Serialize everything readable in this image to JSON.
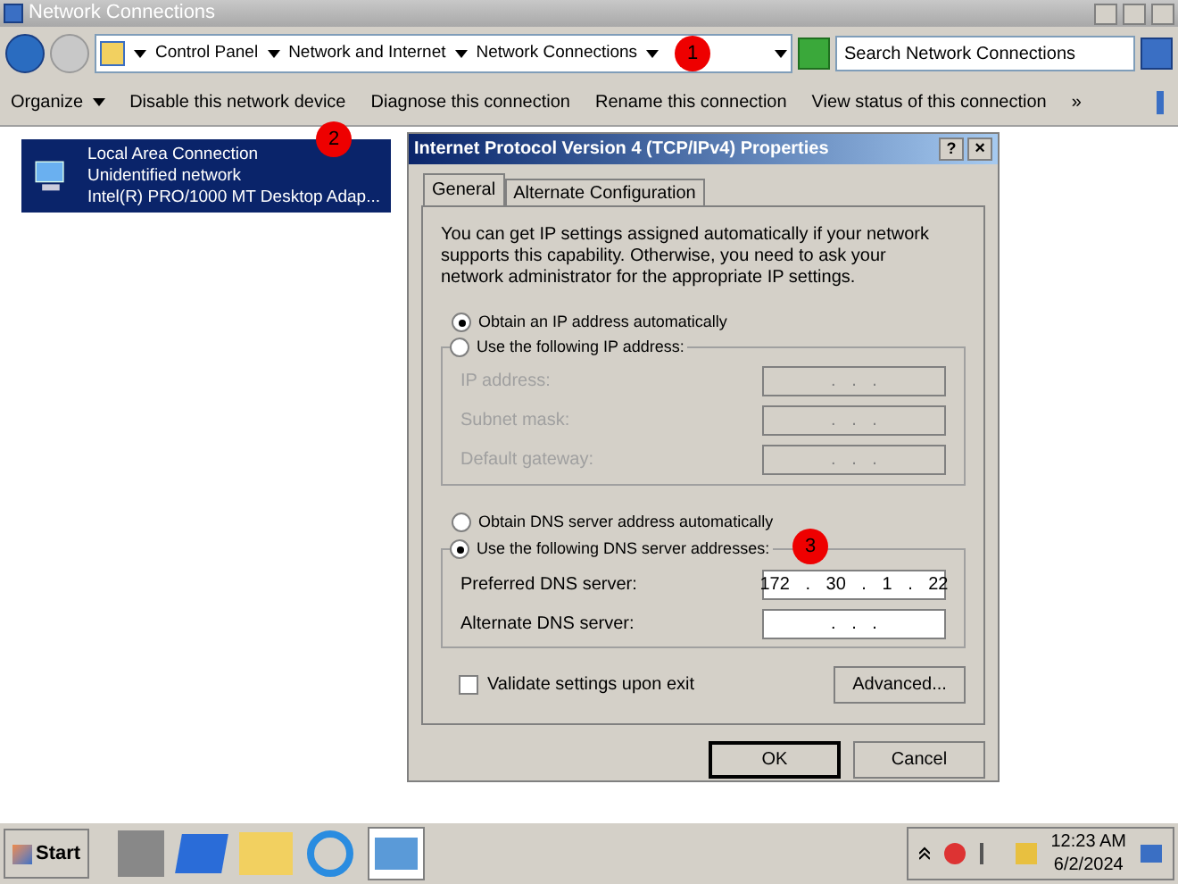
{
  "window": {
    "title": "Network Connections"
  },
  "breadcrumb": [
    "Control Panel",
    "Network and Internet",
    "Network Connections"
  ],
  "search": {
    "placeholder": "Search Network Connections"
  },
  "toolbar": [
    "Organize",
    "Disable this network device",
    "Diagnose this connection",
    "Rename this connection",
    "View status of this connection",
    "»"
  ],
  "connection": {
    "name": "Local Area Connection",
    "status": "Unidentified network",
    "adapter": "Intel(R) PRO/1000 MT Desktop Adap...",
    "selected": true
  },
  "annotations": [
    "1",
    "2",
    "3"
  ],
  "dialog": {
    "title": "Internet Protocol Version 4 (TCP/IPv4) Properties",
    "help": "?",
    "close": "×",
    "tabs": [
      {
        "label": "General",
        "selected": true
      },
      {
        "label": "Alternate Configuration",
        "selected": false
      }
    ],
    "intro": "You can get IP settings assigned automatically if your network supports this capability. Otherwise, you need to ask your network administrator for the appropriate IP settings.",
    "ip_options": [
      {
        "label": "Obtain an IP address automatically",
        "selected": true
      },
      {
        "label": "Use the following IP address:",
        "selected": false
      }
    ],
    "ip_fields": [
      {
        "label": "IP address:",
        "value": ". . .",
        "disabled": true
      },
      {
        "label": "Subnet mask:",
        "value": ". . .",
        "disabled": true
      },
      {
        "label": "Default gateway:",
        "value": ". . .",
        "disabled": true
      }
    ],
    "dns_options": [
      {
        "label": "Obtain DNS server address automatically",
        "selected": false
      },
      {
        "label": "Use the following DNS server addresses:",
        "selected": true
      }
    ],
    "dns_fields": [
      {
        "label": "Preferred DNS server:",
        "value": "172 . 30 . 1 . 22",
        "disabled": false
      },
      {
        "label": "Alternate DNS server:",
        "value": ". . .",
        "disabled": false
      }
    ],
    "validate": {
      "label": "Validate settings upon exit",
      "checked": false
    },
    "advanced": "Advanced...",
    "ok": "OK",
    "cancel": "Cancel"
  },
  "taskbar": {
    "start": "Start",
    "time": "12:23 AM",
    "date": "6/2/2024"
  }
}
